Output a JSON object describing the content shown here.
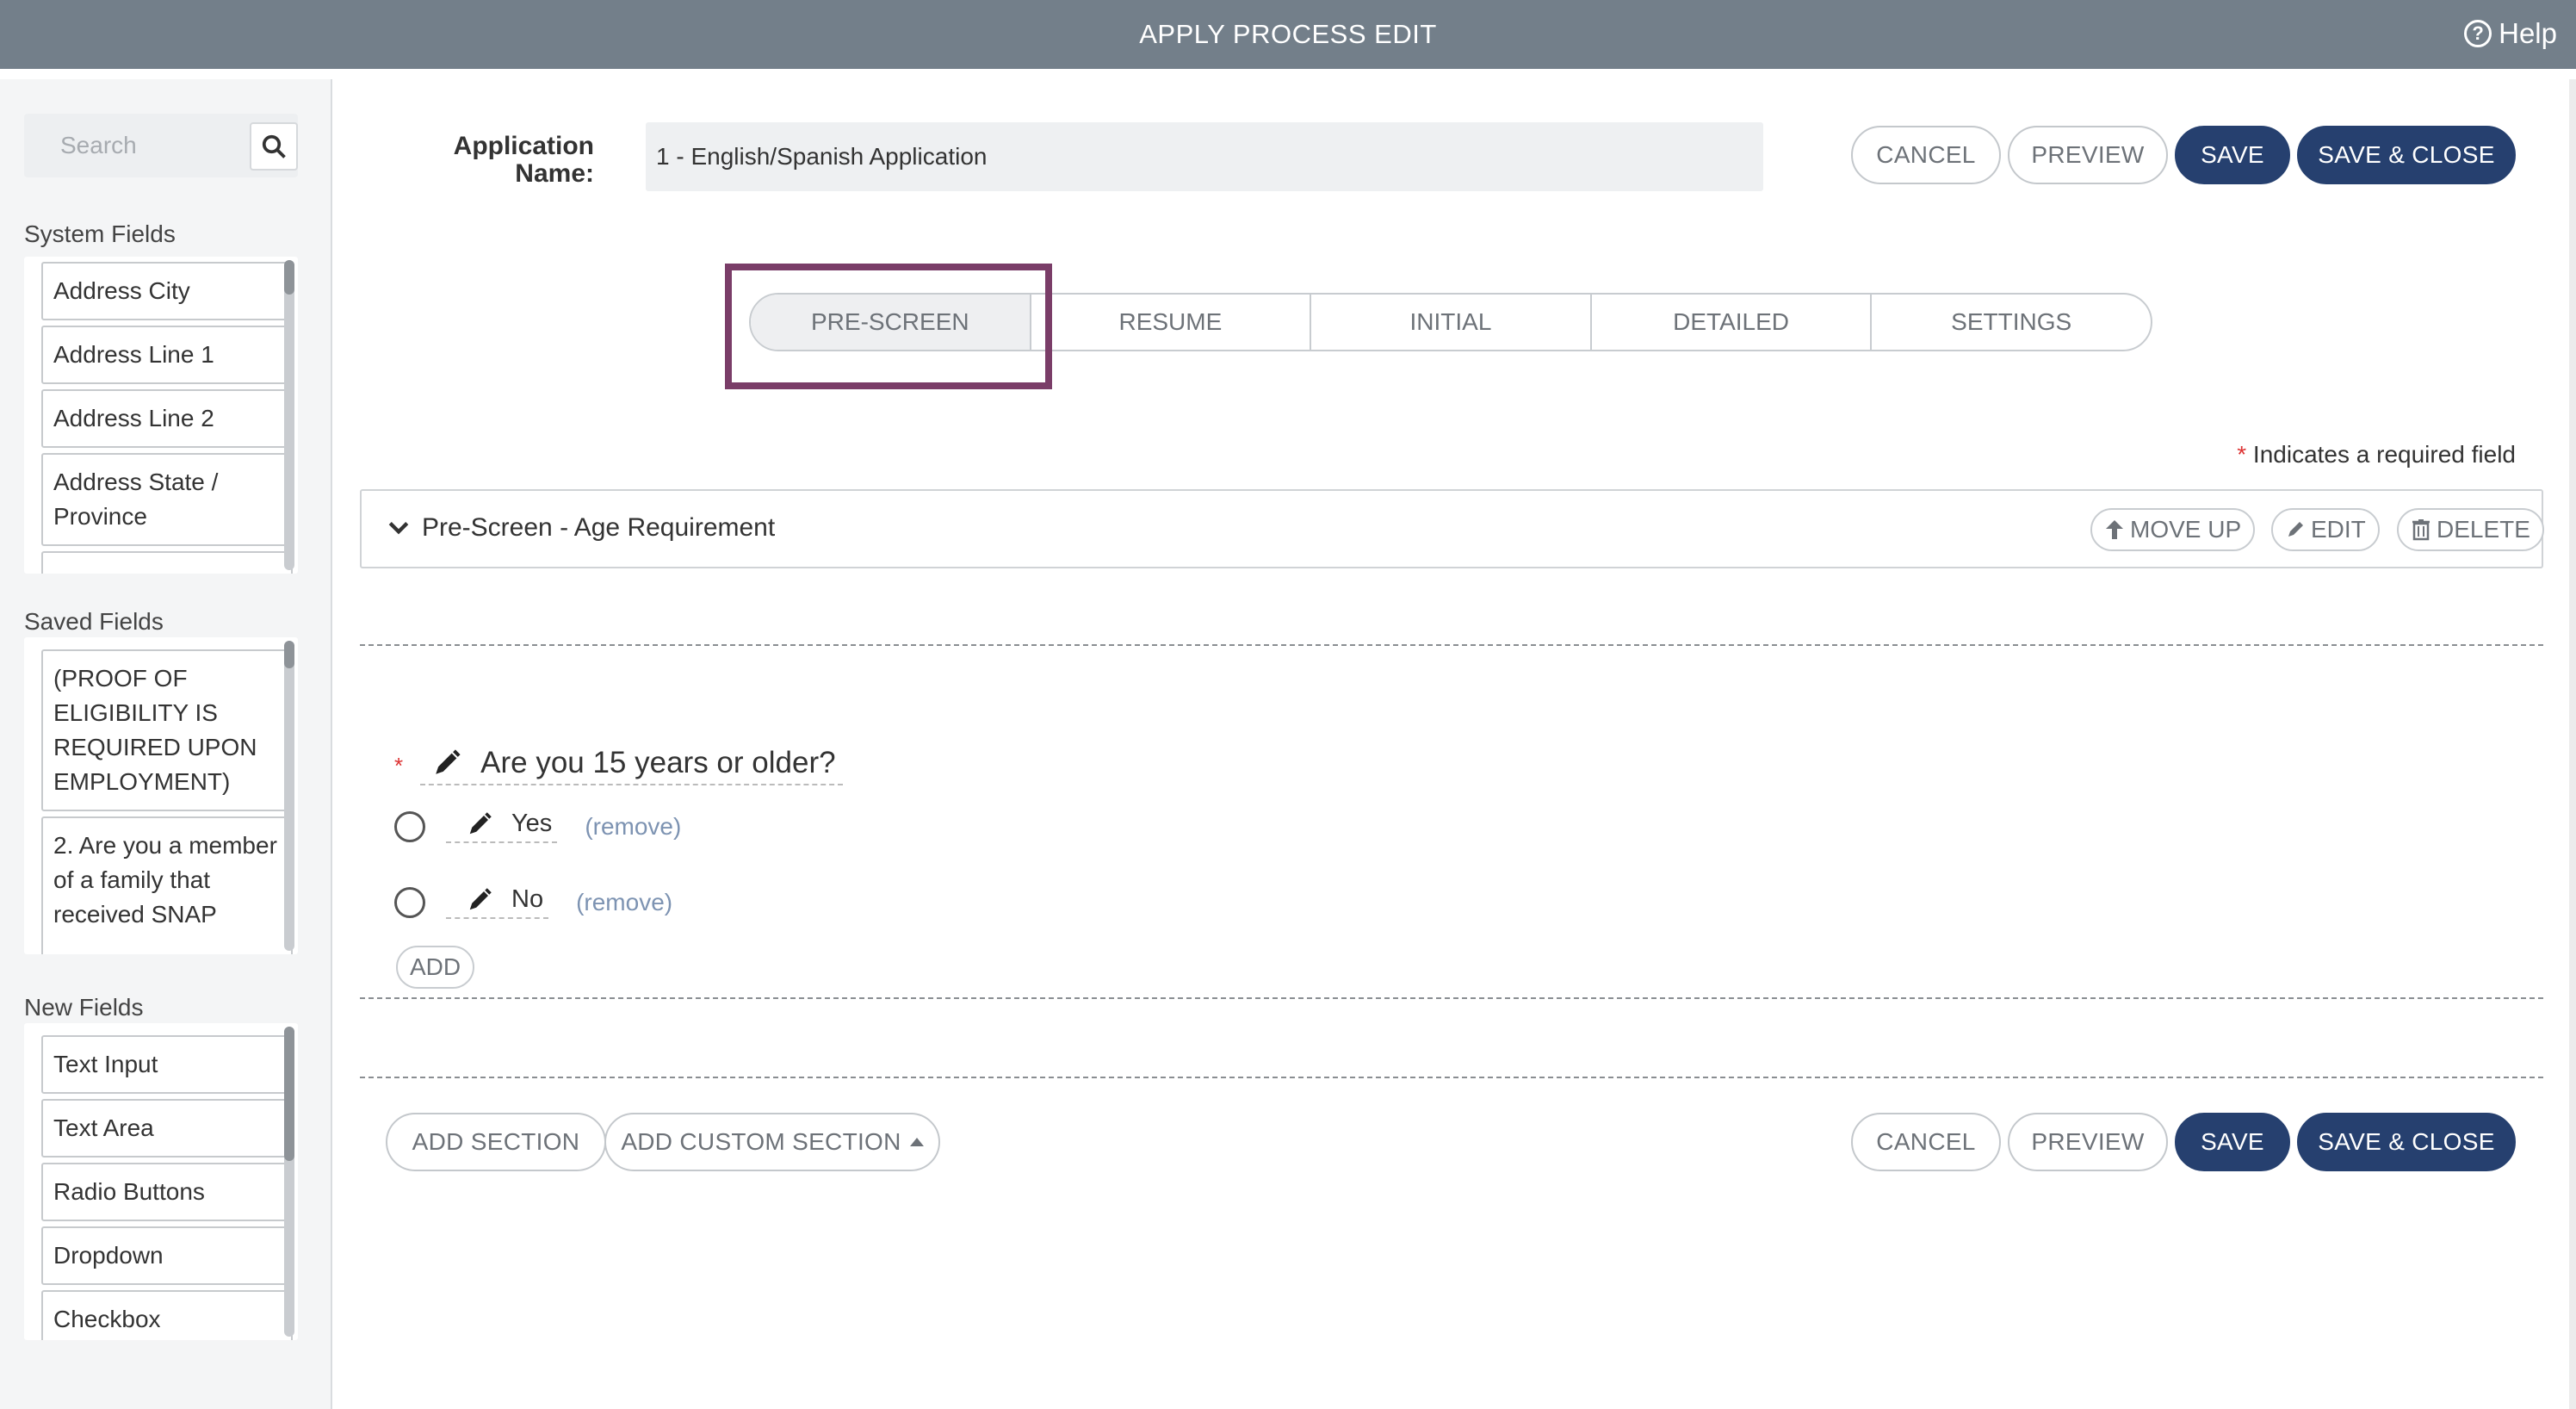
{
  "header": {
    "title": "APPLY PROCESS EDIT",
    "help_label": "Help",
    "help_icon": "question-circle-icon"
  },
  "sidebar": {
    "search": {
      "placeholder": "Search",
      "icon": "search-icon"
    },
    "system_fields": {
      "title": "System Fields",
      "items": [
        "Address City",
        "Address Line 1",
        "Address Line 2",
        "Address State / Province"
      ]
    },
    "saved_fields": {
      "title": "Saved Fields",
      "items": [
        "(PROOF OF ELIGIBILITY IS REQUIRED UPON EMPLOYMENT)",
        "2. Are you a member of a family that received SNAP"
      ]
    },
    "new_fields": {
      "title": "New Fields",
      "items": [
        "Text Input",
        "Text Area",
        "Radio Buttons",
        "Dropdown",
        "Checkbox"
      ]
    }
  },
  "form": {
    "app_name_label": "Application Name:",
    "app_name_value": "1 - English/Spanish Application"
  },
  "actions": {
    "cancel": "CANCEL",
    "preview": "PREVIEW",
    "save": "SAVE",
    "save_close": "SAVE & CLOSE"
  },
  "tabs": [
    {
      "label": "PRE-SCREEN",
      "active": true
    },
    {
      "label": "RESUME",
      "active": false
    },
    {
      "label": "INITIAL",
      "active": false
    },
    {
      "label": "DETAILED",
      "active": false
    },
    {
      "label": "SETTINGS",
      "active": false
    }
  ],
  "required_note": {
    "star": "*",
    "text": "Indicates a required field"
  },
  "section": {
    "title": "Pre-Screen - Age Requirement",
    "move_up": "MOVE UP",
    "edit": "EDIT",
    "delete": "DELETE"
  },
  "question": {
    "required_star": "*",
    "text": "Are you 15 years or older?",
    "options": [
      {
        "label": "Yes",
        "remove": "(remove)"
      },
      {
        "label": "No",
        "remove": "(remove)"
      }
    ],
    "add_label": "ADD"
  },
  "bottom": {
    "add_section": "ADD SECTION",
    "add_custom_section": "ADD CUSTOM SECTION"
  },
  "colors": {
    "header_bg": "#737f8a",
    "primary": "#26406f",
    "highlight": "#7a3d68",
    "required": "#dd3333"
  }
}
